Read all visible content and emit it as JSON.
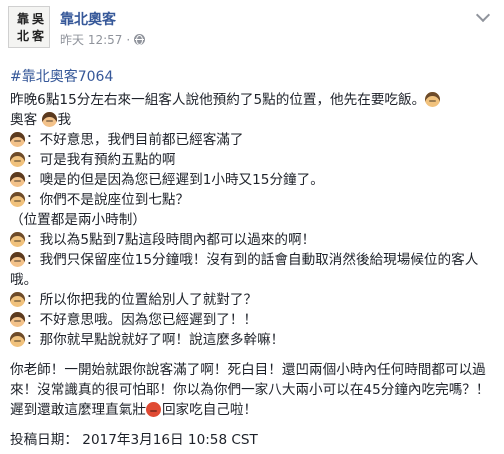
{
  "post": {
    "avatar_glyphs": [
      "靠",
      "吳",
      "北",
      "客"
    ],
    "page_name": "靠北奧客",
    "timestamp": "昨天 12:57",
    "audience_icon": "globe-icon",
    "hashtag": "#靠北奧客7064"
  },
  "content": {
    "intro_1": "昨晚6點15分左右來一組客人說他預約了5點的位置，他先在要吃飯。",
    "intro_2_label": "奧客",
    "intro_2_me": "我",
    "dialogue": [
      {
        "speaker": "woman",
        "text": "：不好意思，我們目前都已經客滿了"
      },
      {
        "speaker": "man",
        "text": "：可是我有預約五點的啊"
      },
      {
        "speaker": "woman",
        "text": "：噢是的但是因為您已經遲到1小時又15分鐘了。"
      },
      {
        "speaker": "man",
        "text": "：你們不是說座位到七點？"
      },
      {
        "speaker": "none",
        "text": "（位置都是兩小時制）"
      },
      {
        "speaker": "man",
        "text": "：我以為5點到7點這段時間內都可以過來的啊！"
      },
      {
        "speaker": "woman",
        "text": "：我們只保留座位15分鐘哦！沒有到的話會自動取消然後給現場候位的客人哦。"
      },
      {
        "speaker": "man",
        "text": "：所以你把我的位置給別人了就對了？"
      },
      {
        "speaker": "woman",
        "text": "：不好意思哦。因為您已經遲到了！！"
      },
      {
        "speaker": "man",
        "text": "：那你就早點說就好了啊！說這麼多幹嘛！"
      }
    ],
    "rant_1": "你老師！一開始就跟你說客滿了啊！死白目！還凹兩個小時內任何時間都可以過來！沒常識真的很可怕耶！你以為你們一家八大兩小可以在45分鐘內吃完嗎？！遲到還敢這麼理直氣壯",
    "rant_2": "回家吃自己啦！",
    "posted_date": "投稿日期： 2017年3月16日 10:58 CST"
  }
}
